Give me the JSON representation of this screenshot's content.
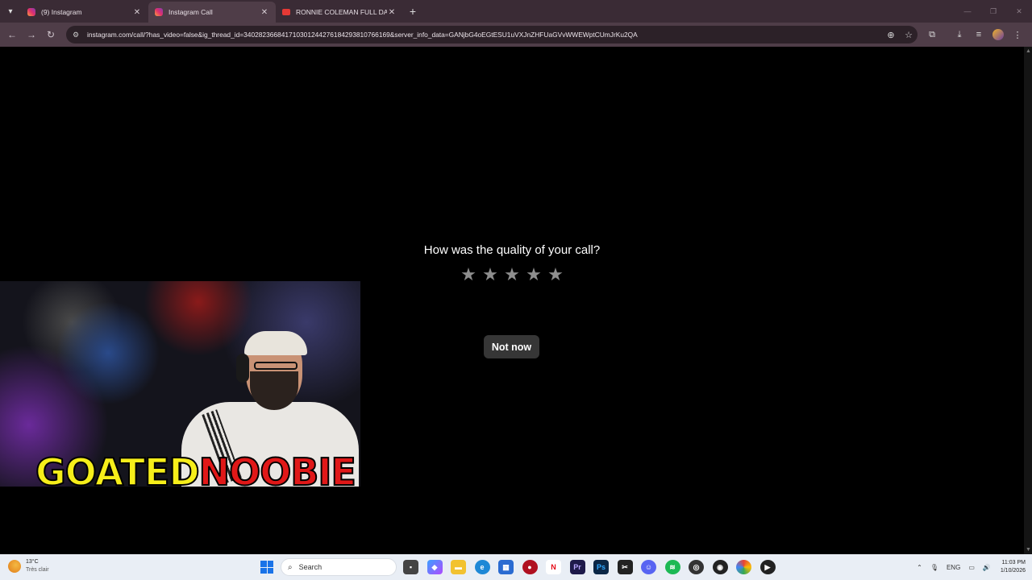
{
  "browser": {
    "tabs": [
      {
        "label": "(9) Instagram",
        "icon": "instagram-icon",
        "active": false
      },
      {
        "label": "Instagram Call",
        "icon": "instagram-icon",
        "active": true
      },
      {
        "label": "RONNIE COLEMAN FULL DAY O",
        "icon": "youtube-icon",
        "active": false
      }
    ],
    "url": "instagram.com/call/?has_video=false&ig_thread_id=340282366841710301244276184293810766169&server_info_data=GANjbG4oEGtESU1uVXJnZHFUaGVvWWEWptCUmJrKu2QA"
  },
  "call_rating": {
    "question": "How was the quality of your call?",
    "star_count": 5,
    "selected_rating": 0,
    "dismiss_label": "Not now"
  },
  "webcam": {
    "overlay_part1": "GOATED",
    "overlay_part2": "NOOBIE"
  },
  "taskbar": {
    "weather_temp": "13°C",
    "weather_desc": "Très clair",
    "search_placeholder": "Search",
    "language": "ENG",
    "time": "11:03 PM",
    "date": "1/10/2026"
  }
}
